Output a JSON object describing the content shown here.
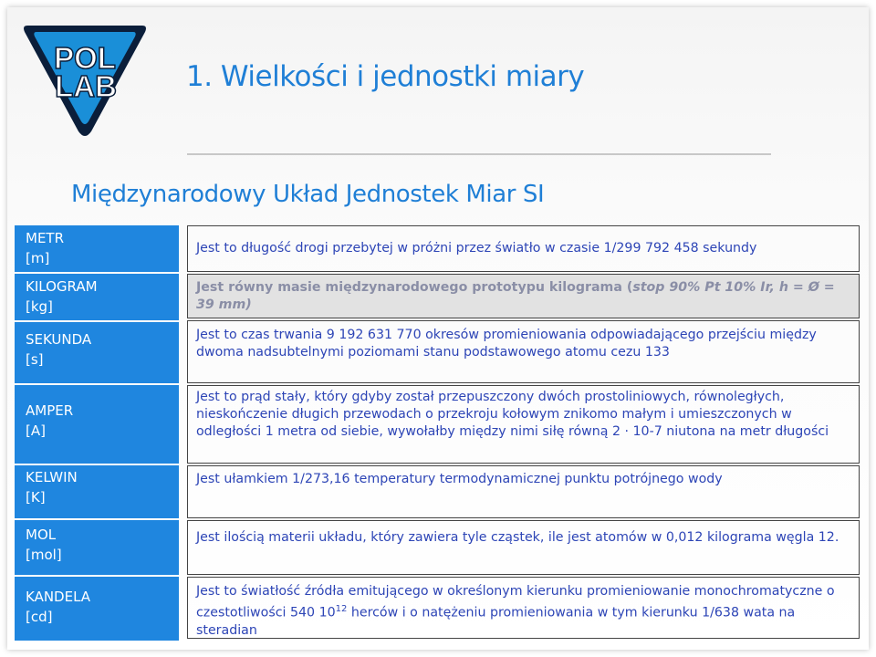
{
  "logo": {
    "line1": "POL",
    "line2": "LAB"
  },
  "title": "1. Wielkości i jednostki miary",
  "subtitle": "Międzynarodowy Układ Jednostek Miar SI",
  "units": [
    {
      "name": "METR",
      "symbol": "[m]"
    },
    {
      "name": "KILOGRAM",
      "symbol": "[kg]"
    },
    {
      "name": "SEKUNDA",
      "symbol": "[s]"
    },
    {
      "name": "AMPER",
      "symbol": "[A]"
    },
    {
      "name": "KELWIN",
      "symbol": "[K]"
    },
    {
      "name": "MOL",
      "symbol": "[mol]"
    },
    {
      "name": "KANDELA",
      "symbol": "[cd]"
    }
  ],
  "descriptions": {
    "metr": "Jest to długość drogi przebytej w próżni przez światło w czasie 1/299 792 458 sekundy",
    "kilogram_main": "Jest równy masie międzynarodowego prototypu kilograma (",
    "kilogram_tail": "stop 90% Pt 10% Ir, h = Ø = 39 mm)",
    "sekunda": "Jest to czas trwania 9 192 631 770 okresów promieniowania odpowiadającego przejściu między dwoma nadsubtelnymi poziomami stanu podstawowego atomu cezu 133",
    "amper": "Jest to prąd stały, który gdyby został przepuszczony dwóch prostoliniowych, równoległych, nieskończenie długich przewodach o przekroju kołowym znikomo małym i umieszczonych w odległości 1 metra od siebie, wywołałby między nimi siłę równą 2 · 10-7 niutona na metr długości",
    "kelwin": "Jest ułamkiem 1/273,16 temperatury termodynamicznej punktu potrójnego wody",
    "mol": "Jest ilością materii układu, który zawiera tyle cząstek, ile jest atomów w 0,012 kilograma węgla 12.",
    "kandela_a": "Jest to światłość źródła emitującego w określonym kierunku promieniowanie monochromatyczne o czestotliwości 540 10",
    "kandela_exp": "12",
    "kandela_b": " herców i o natężeniu promieniowania w tym kierunku 1/638 wata na steradian"
  },
  "colors": {
    "accent": "#1f7fd6",
    "unit_fill": "#1f86df",
    "desc_text": "#2d45b6",
    "highlight_fill": "#e2e2e2",
    "logo_blue": "#1a8fd8",
    "logo_dark": "#0b1e3a"
  },
  "icons": {
    "logo": "pollab-triangle-logo"
  }
}
